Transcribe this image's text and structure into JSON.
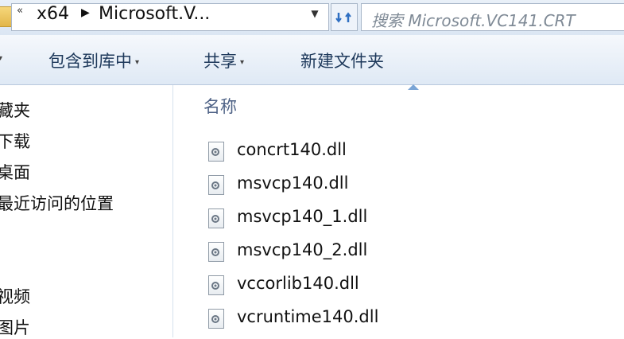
{
  "address_bar": {
    "overflow_chevron": "«",
    "crumbs": [
      "x64",
      "Microsoft.V..."
    ],
    "separator": "▶",
    "dropdown_arrow": "▼"
  },
  "search": {
    "placeholder": "搜索 Microsoft.VC141.CRT"
  },
  "toolbar": {
    "include_in_library": "包含到库中",
    "share": "共享",
    "new_folder": "新建文件夹",
    "dropdown_glyph": "▾"
  },
  "nav_pane": {
    "items": [
      "藏夹",
      "下载",
      "桌面",
      "最近访问的位置",
      "视频",
      "图片"
    ]
  },
  "main": {
    "column_name": "名称",
    "files": [
      "concrt140.dll",
      "msvcp140.dll",
      "msvcp140_1.dll",
      "msvcp140_2.dll",
      "vccorlib140.dll",
      "vcruntime140.dll"
    ]
  },
  "icons": {
    "file": "dll-file-icon",
    "folder": "folder-icon",
    "refresh": "refresh-icon"
  },
  "colors": {
    "toolbar_text": "#1e395b",
    "header_text": "#4d6185",
    "accent": "#7aa5d6"
  }
}
